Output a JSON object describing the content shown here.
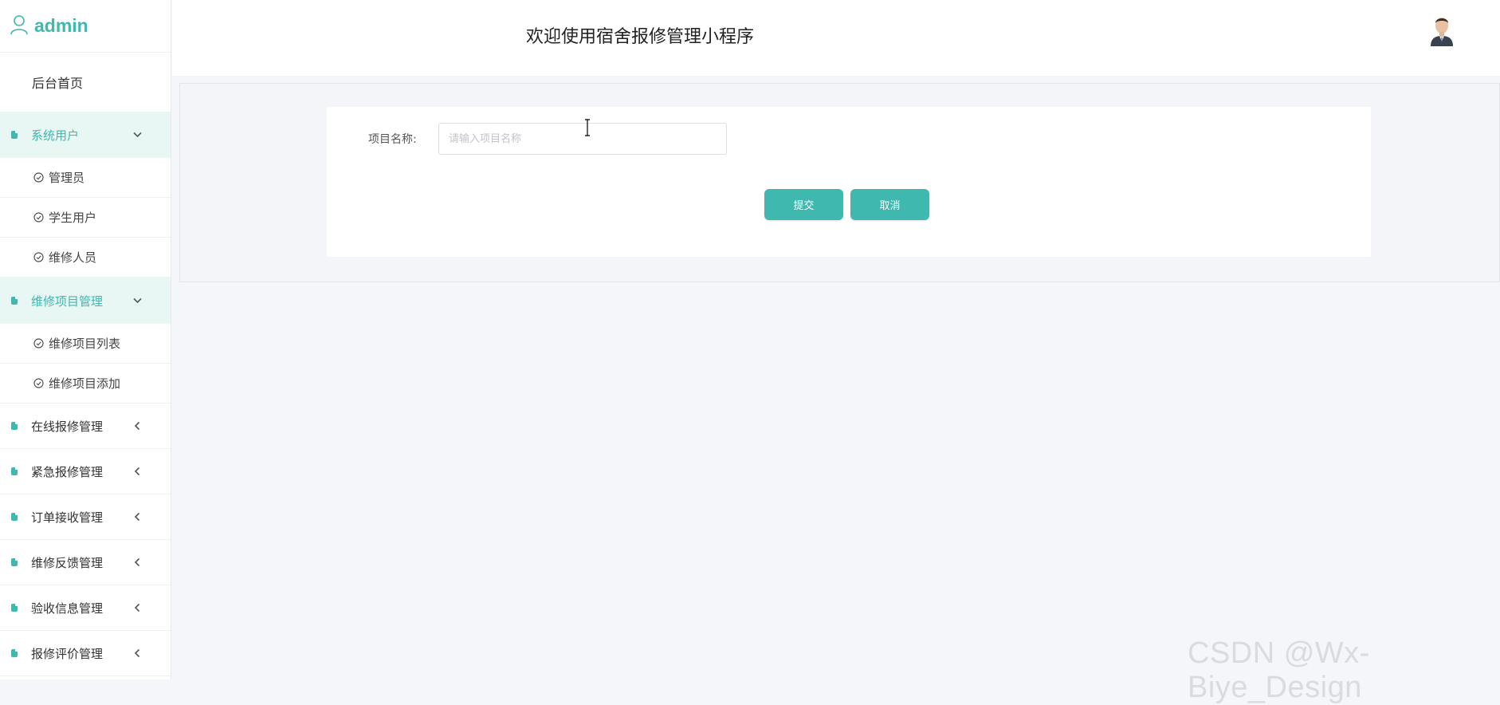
{
  "brand": {
    "name": "admin",
    "color": "#3fb8b0"
  },
  "header": {
    "title": "欢迎使用宿舍报修管理小程序"
  },
  "sidebar": {
    "home": "后台首页",
    "groups": [
      {
        "label": "系统用户",
        "expanded": true,
        "items": [
          "管理员",
          "学生用户",
          "维修人员"
        ]
      },
      {
        "label": "维修项目管理",
        "expanded": true,
        "items": [
          "维修项目列表",
          "维修项目添加"
        ]
      },
      {
        "label": "在线报修管理",
        "expanded": false
      },
      {
        "label": "紧急报修管理",
        "expanded": false
      },
      {
        "label": "订单接收管理",
        "expanded": false
      },
      {
        "label": "维修反馈管理",
        "expanded": false
      },
      {
        "label": "验收信息管理",
        "expanded": false
      },
      {
        "label": "报修评价管理",
        "expanded": false
      }
    ]
  },
  "form": {
    "field_label": "项目名称:",
    "field_placeholder": "请输入项目名称",
    "field_value": "",
    "submit_label": "提交",
    "cancel_label": "取消"
  },
  "watermark": "CSDN @Wx-Biye_Design",
  "icons": {
    "user": "user-icon",
    "doc": "document-icon",
    "check": "check-circle-icon",
    "chevron_down": "chevron-down-icon",
    "chevron_left": "chevron-left-icon",
    "avatar": "avatar"
  }
}
